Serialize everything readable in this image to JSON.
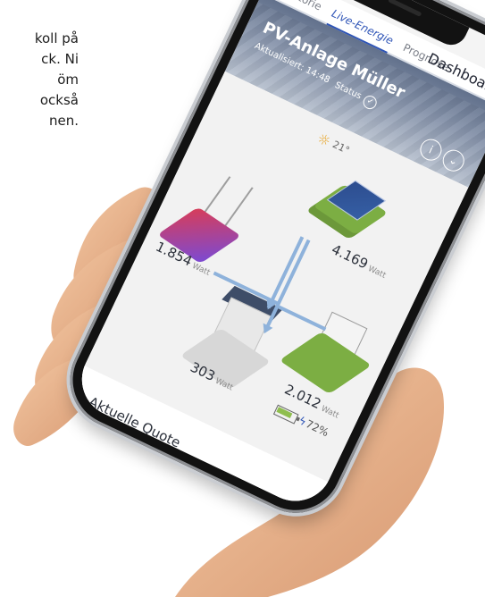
{
  "intro": {
    "lines": [
      "koll på",
      "ck. Ni",
      "öm",
      "också",
      "nen."
    ]
  },
  "app": {
    "tabs": [
      "Historie",
      "Live-Energie",
      "Prognose"
    ],
    "active_tab": "Live-Energie",
    "dashboard_title": "Dashboard",
    "plant_name": "PV-Anlage Müller",
    "updated": "Aktualisiert: 14:48",
    "status_label": "Status",
    "weather": {
      "temperature": "21°",
      "icon": "sun-icon"
    },
    "energy": {
      "solar": {
        "value": "4.169",
        "unit": "Watt"
      },
      "grid": {
        "value": "1.854",
        "unit": "Watt"
      },
      "home": {
        "value": "303",
        "unit": "Watt"
      },
      "battery": {
        "value": "2.012",
        "unit": "Watt",
        "charge": "72%"
      }
    },
    "section_title": "Aktuelle Quote",
    "colors": {
      "accent": "#2f55b7",
      "solar_green": "#7cae43",
      "grid_red": "#d93d57",
      "grid_purple": "#7a4ad5",
      "banner": "#6f7f9b"
    }
  }
}
